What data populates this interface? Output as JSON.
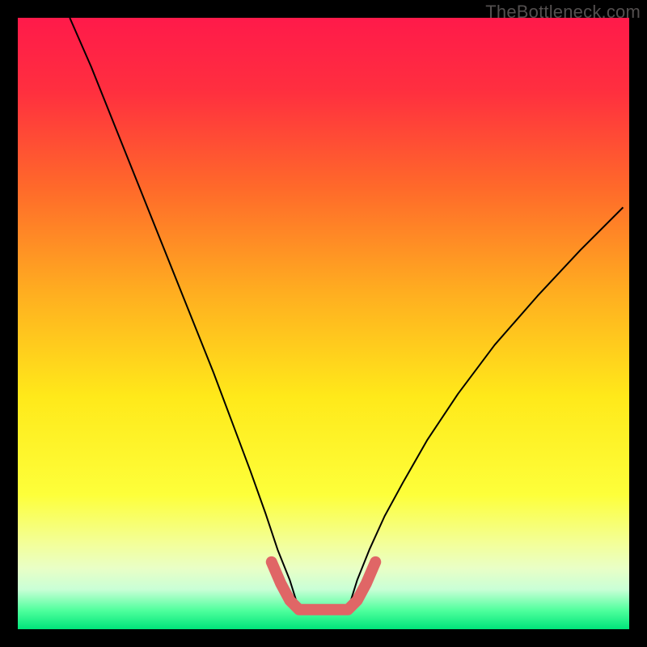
{
  "watermark": "TheBottleneck.com",
  "gradient": {
    "stops": [
      {
        "offset": 0.0,
        "color": "#ff1a4a"
      },
      {
        "offset": 0.12,
        "color": "#ff2f3f"
      },
      {
        "offset": 0.28,
        "color": "#ff6a2a"
      },
      {
        "offset": 0.45,
        "color": "#ffae20"
      },
      {
        "offset": 0.62,
        "color": "#ffe91a"
      },
      {
        "offset": 0.78,
        "color": "#fdff3a"
      },
      {
        "offset": 0.86,
        "color": "#f3ff99"
      },
      {
        "offset": 0.9,
        "color": "#e9ffc6"
      },
      {
        "offset": 0.935,
        "color": "#c9ffd6"
      },
      {
        "offset": 0.97,
        "color": "#4dff9c"
      },
      {
        "offset": 1.0,
        "color": "#00e47a"
      }
    ]
  },
  "chart_data": {
    "type": "line",
    "title": "",
    "xlabel": "",
    "ylabel": "",
    "xlim": [
      0,
      100
    ],
    "ylim": [
      0,
      100
    ],
    "grid": false,
    "legend": false,
    "series": [
      {
        "name": "curve",
        "color": "#000000",
        "stroke_width": 2,
        "x": [
          8.5,
          12,
          16,
          20,
          24,
          28,
          32,
          35,
          38,
          40.5,
          42.5,
          44.5,
          46,
          54,
          55.5,
          57.5,
          60,
          63,
          67,
          72,
          78,
          85,
          92,
          99
        ],
        "y": [
          100,
          92,
          82,
          72,
          62,
          52,
          42,
          34,
          26,
          19,
          13,
          8,
          3.2,
          3.2,
          8,
          13,
          18.5,
          24,
          31,
          38.5,
          46.5,
          54.5,
          62,
          69
        ]
      },
      {
        "name": "flat-segment",
        "color": "#e06666",
        "stroke_width": 14,
        "linecap": "round",
        "x": [
          41.5,
          43,
          44.5,
          46,
          48,
          50,
          52,
          54,
          55.5,
          57,
          58.5
        ],
        "y": [
          11,
          7.5,
          4.7,
          3.2,
          3.2,
          3.2,
          3.2,
          3.2,
          4.7,
          7.5,
          11
        ]
      }
    ]
  }
}
